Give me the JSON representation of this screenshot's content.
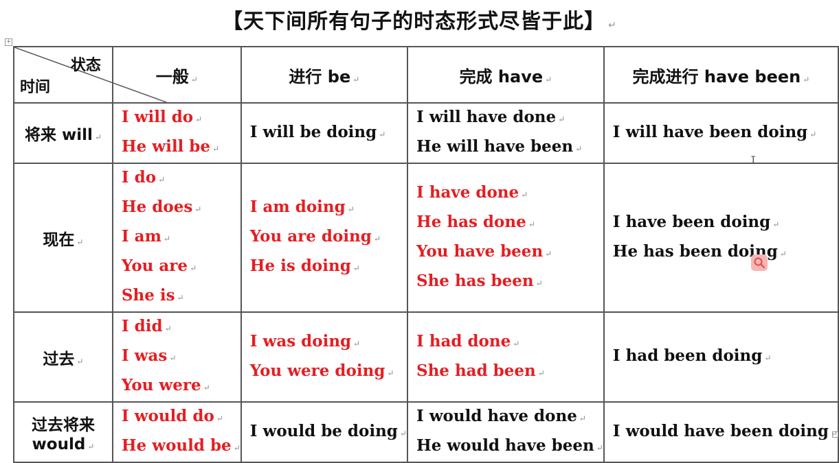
{
  "title": "【天下间所有句子的时态形式尽皆于此】",
  "header": {
    "corner_state": "状态",
    "corner_time": "时间",
    "columns": [
      "一般",
      "进行 be",
      "完成  have",
      "完成进行  have been"
    ]
  },
  "rows": [
    {
      "label": "将来  will",
      "cells": [
        {
          "color": "red",
          "lines": [
            "I will do",
            "He will be"
          ]
        },
        {
          "color": "black",
          "lines": [
            "I will be doing"
          ]
        },
        {
          "color": "black",
          "lines": [
            "I will have done",
            "He will have been"
          ]
        },
        {
          "color": "black",
          "lines": [
            "I will have been doing"
          ]
        }
      ]
    },
    {
      "label": "现在",
      "cells": [
        {
          "color": "red",
          "lines": [
            "I do",
            "He does",
            "I am",
            "You are",
            "She is"
          ]
        },
        {
          "color": "red",
          "lines": [
            "I am doing",
            "You are doing",
            "He is doing"
          ]
        },
        {
          "color": "red",
          "lines": [
            "I have done",
            "He has done",
            "You have been",
            "She has been"
          ]
        },
        {
          "color": "black",
          "lines": [
            "I have been doing",
            "He has been doing"
          ]
        }
      ]
    },
    {
      "label": "过去",
      "cells": [
        {
          "color": "red",
          "lines": [
            "I did",
            "I was",
            "You were"
          ]
        },
        {
          "color": "red",
          "lines": [
            "I was doing",
            "You were doing"
          ]
        },
        {
          "color": "red",
          "lines": [
            "I had done",
            "She had been"
          ]
        },
        {
          "color": "black",
          "lines": [
            "I had been doing"
          ]
        }
      ]
    },
    {
      "label": "过去将来  would",
      "cells": [
        {
          "color": "red",
          "lines": [
            "I would do",
            "He would be"
          ]
        },
        {
          "color": "black",
          "lines": [
            "I would be doing"
          ]
        },
        {
          "color": "black",
          "lines": [
            "I would have done",
            "He would have been"
          ]
        },
        {
          "color": "black",
          "lines": [
            "I would have been doing"
          ]
        }
      ]
    }
  ],
  "colors": {
    "red_text": "#e41e22",
    "black_text": "#111111",
    "grid_line": "#555555"
  },
  "icons": {
    "table_anchor": "table-move-handle-icon",
    "search": "magnifier-icon",
    "text_cursor": "i-beam-cursor-icon"
  }
}
